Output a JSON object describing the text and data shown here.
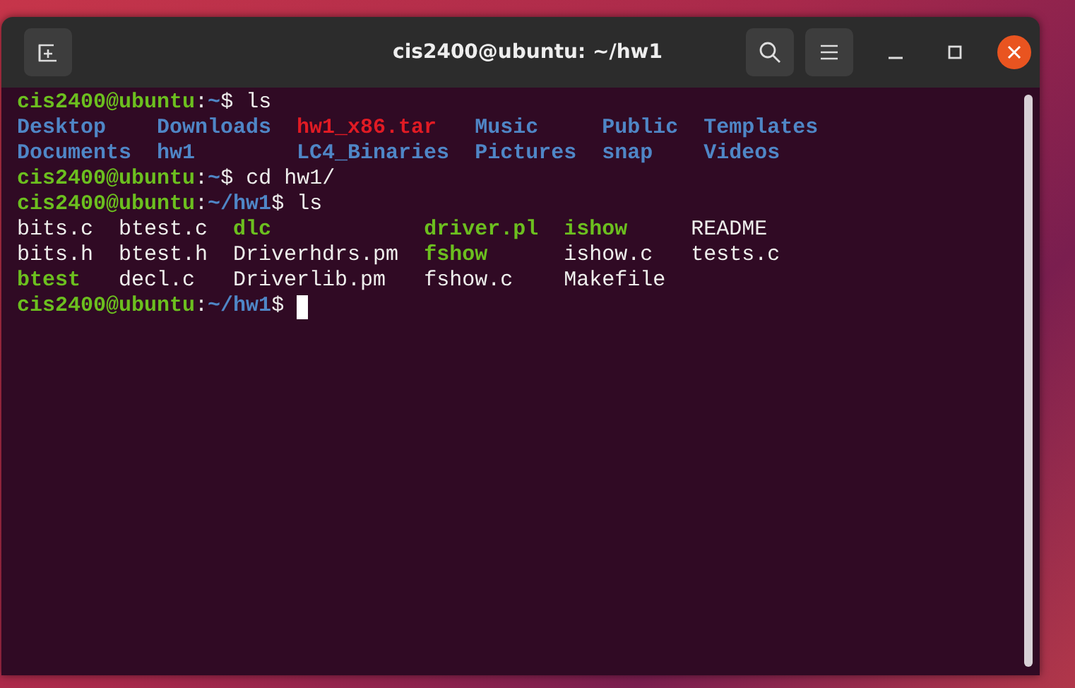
{
  "window": {
    "title": "cis2400@ubuntu: ~/hw1"
  },
  "terminal": {
    "lines": [
      {
        "kind": "prompt",
        "segments": [
          {
            "text": "cis2400@ubuntu",
            "kind": "user"
          },
          {
            "text": ":",
            "kind": "plain"
          },
          {
            "text": "~",
            "kind": "path"
          },
          {
            "text": "$ ls",
            "kind": "plain"
          }
        ],
        "cursor": false
      },
      {
        "kind": "listing",
        "rows": [
          [
            {
              "name": "Desktop",
              "kind": "dir"
            },
            {
              "name": "Downloads",
              "kind": "dir"
            },
            {
              "name": "hw1_x86.tar",
              "kind": "archive"
            },
            {
              "name": "Music",
              "kind": "dir"
            },
            {
              "name": "Public",
              "kind": "dir"
            },
            {
              "name": "Templates",
              "kind": "dir"
            }
          ],
          [
            {
              "name": "Documents",
              "kind": "dir"
            },
            {
              "name": "hw1",
              "kind": "dir"
            },
            {
              "name": "LC4_Binaries",
              "kind": "dir"
            },
            {
              "name": "Pictures",
              "kind": "dir"
            },
            {
              "name": "snap",
              "kind": "dir"
            },
            {
              "name": "Videos",
              "kind": "dir"
            }
          ]
        ]
      },
      {
        "kind": "prompt",
        "segments": [
          {
            "text": "cis2400@ubuntu",
            "kind": "user"
          },
          {
            "text": ":",
            "kind": "plain"
          },
          {
            "text": "~",
            "kind": "path"
          },
          {
            "text": "$ cd hw1/",
            "kind": "plain"
          }
        ],
        "cursor": false
      },
      {
        "kind": "prompt",
        "segments": [
          {
            "text": "cis2400@ubuntu",
            "kind": "user"
          },
          {
            "text": ":",
            "kind": "plain"
          },
          {
            "text": "~/hw1",
            "kind": "path"
          },
          {
            "text": "$ ls",
            "kind": "plain"
          }
        ],
        "cursor": false
      },
      {
        "kind": "listing",
        "rows": [
          [
            {
              "name": "bits.c",
              "kind": "file"
            },
            {
              "name": "btest.c",
              "kind": "file"
            },
            {
              "name": "dlc",
              "kind": "exec"
            },
            {
              "name": "driver.pl",
              "kind": "exec"
            },
            {
              "name": "ishow",
              "kind": "exec"
            },
            {
              "name": "README",
              "kind": "file"
            }
          ],
          [
            {
              "name": "bits.h",
              "kind": "file"
            },
            {
              "name": "btest.h",
              "kind": "file"
            },
            {
              "name": "Driverhdrs.pm",
              "kind": "file"
            },
            {
              "name": "fshow",
              "kind": "exec"
            },
            {
              "name": "ishow.c",
              "kind": "file"
            },
            {
              "name": "tests.c",
              "kind": "file"
            }
          ],
          [
            {
              "name": "btest",
              "kind": "exec"
            },
            {
              "name": "decl.c",
              "kind": "file"
            },
            {
              "name": "Driverlib.pm",
              "kind": "file"
            },
            {
              "name": "fshow.c",
              "kind": "file"
            },
            {
              "name": "Makefile",
              "kind": "file"
            }
          ]
        ]
      },
      {
        "kind": "prompt",
        "segments": [
          {
            "text": "cis2400@ubuntu",
            "kind": "user"
          },
          {
            "text": ":",
            "kind": "plain"
          },
          {
            "text": "~/hw1",
            "kind": "path"
          },
          {
            "text": "$ ",
            "kind": "plain"
          }
        ],
        "cursor": true
      }
    ]
  }
}
